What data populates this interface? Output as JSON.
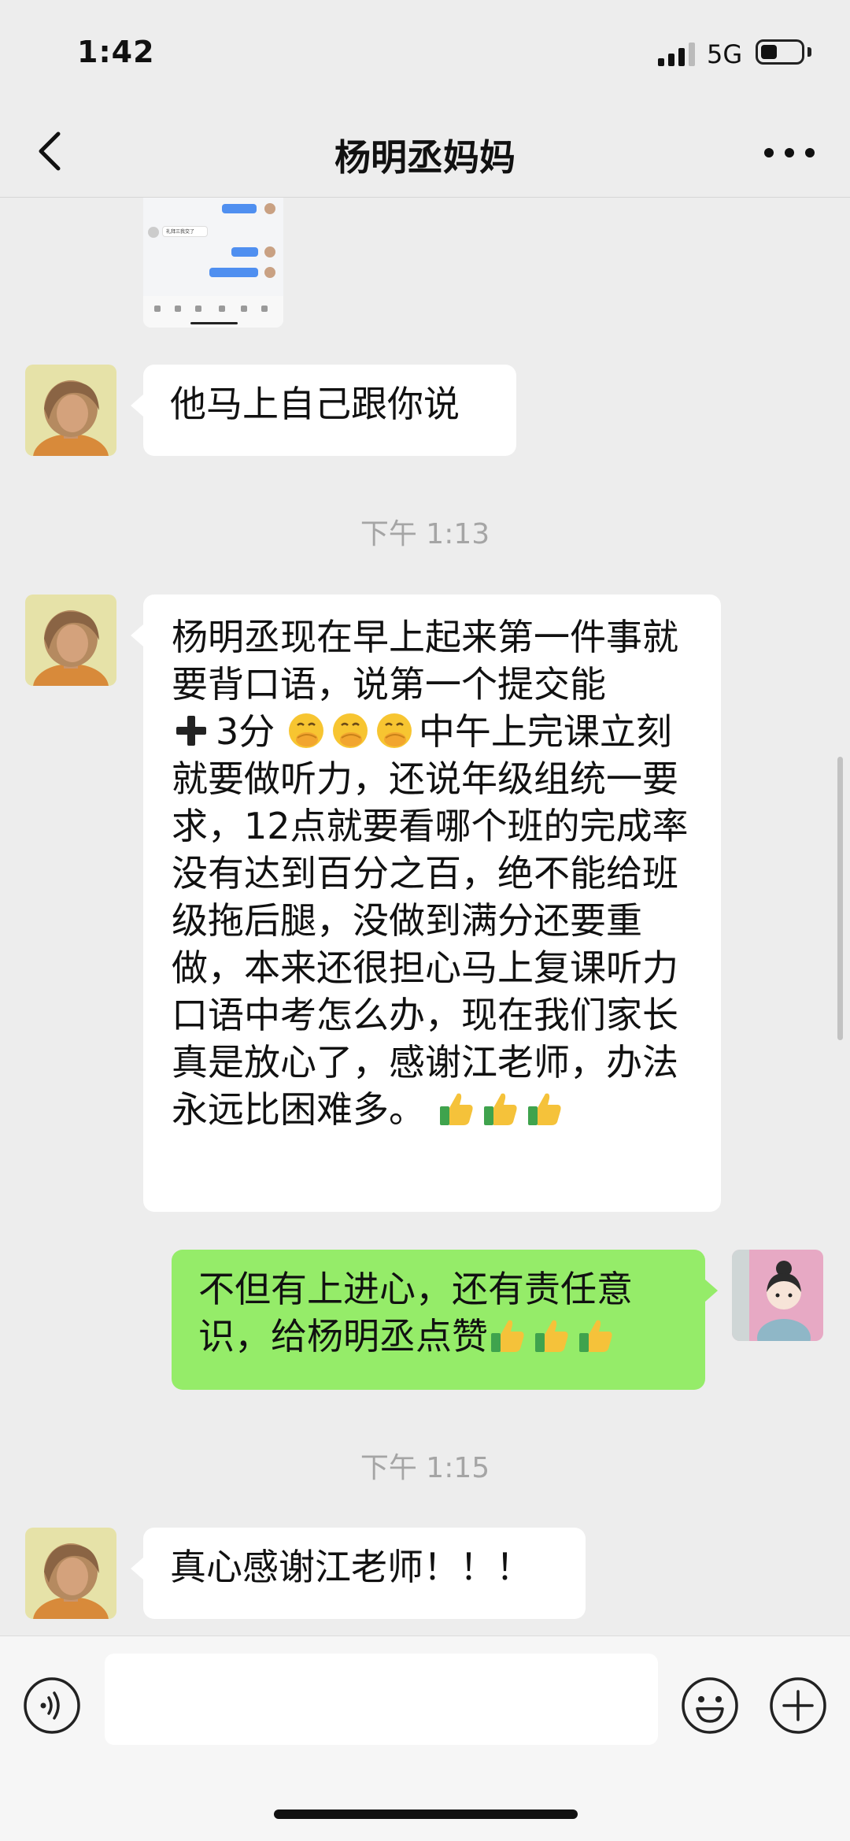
{
  "status_bar": {
    "time": "1:42",
    "network": "5G",
    "battery_level": 0.4
  },
  "header": {
    "title": "杨明丞妈妈"
  },
  "messages": [
    {
      "text": "他马上自己跟你说"
    },
    {
      "text": "杨明丞现在早上起来第一件事就要背口语，说第一个提交能",
      "line2": "3分",
      "line3": "中午上完课立刻就要做听力，还说年级组统一要求，12点就要看哪个班的完成率没有达到百分之百，绝不能给班级拖后腿，没做到满分还要重做，本来还很担心马上复课听力口语中考怎么办，现在我们家长真是放心了，感谢江老师，办法永远比困难多。"
    },
    {
      "text": "不但有上进心，还有责任意识，给杨明丞点赞"
    },
    {
      "text": "真心感谢江老师！！！"
    }
  ],
  "timestamps": [
    "下午 1:13",
    "下午 1:15"
  ],
  "thumbnail": {
    "text": "礼拜三我交了"
  },
  "icons": {
    "back": "chevron-left-icon",
    "more": "more-icon",
    "voice": "voice-icon",
    "emoji": "emoji-icon",
    "plus": "plus-icon",
    "thumbs_up": "thumbs-up-icon",
    "hand_over_mouth": "hand-over-mouth-icon",
    "heavy_plus": "heavy-plus-icon"
  },
  "colors": {
    "outgoing_bubble": "#95ec69",
    "incoming_bubble": "#ffffff",
    "background": "#ededed"
  }
}
